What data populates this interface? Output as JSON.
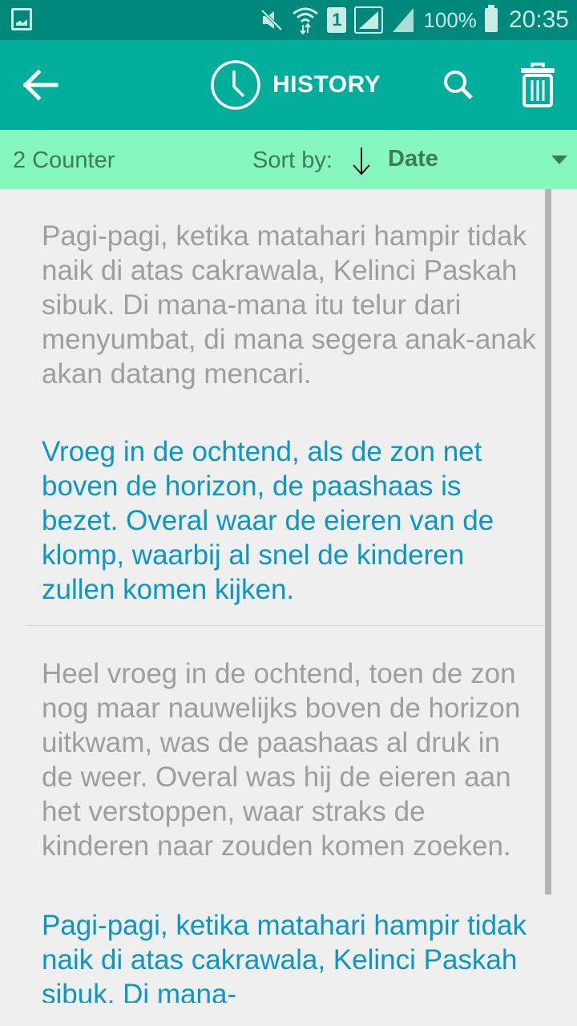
{
  "status_bar": {
    "left_icons": [
      "gallery-icon"
    ],
    "right_icons": [
      "mute-icon",
      "wifi-icon",
      "sim-1-icon",
      "signal-icon",
      "signal-2-icon",
      "battery-icon"
    ],
    "sim_label": "1",
    "battery": "100%",
    "time": "20:35"
  },
  "app_bar": {
    "title": "HISTORY",
    "title_icon": "clock-icon",
    "back_icon": "arrow-left-icon",
    "search_icon": "search-icon",
    "delete_icon": "trash-icon"
  },
  "sort_bar": {
    "counter": "2 Counter",
    "sort_label": "Sort by:",
    "sort_direction_icon": "arrow-down-icon",
    "sort_value": "Date"
  },
  "history": [
    {
      "source": "Pagi-pagi, ketika matahari hampir tidak naik di atas cakrawala, Kelinci Paskah sibuk. Di mana-mana itu telur dari menyumbat, di mana segera anak-anak akan datang mencari.",
      "translation": "Vroeg in de ochtend, als de zon net boven de horizon, de paashaas is bezet. Overal waar de eieren van de klomp, waarbij al snel de kinderen zullen komen kijken."
    },
    {
      "source": "Heel vroeg in de ochtend, toen de zon nog maar nauwelijks boven de horizon uitkwam, was de paashaas al druk in de weer. Overal was hij de eieren aan het verstoppen, waar straks de kinderen naar zouden komen zoeken.",
      "translation": "Pagi-pagi, ketika matahari hampir tidak naik di atas cakrawala, Kelinci Paskah sibuk. Di mana-"
    }
  ],
  "colors": {
    "status_bar": "#00897b",
    "app_bar": "#00ae9b",
    "sort_bar": "#85f7bf",
    "source_text": "#9e9e9e",
    "translation_text": "#0b97c6"
  }
}
